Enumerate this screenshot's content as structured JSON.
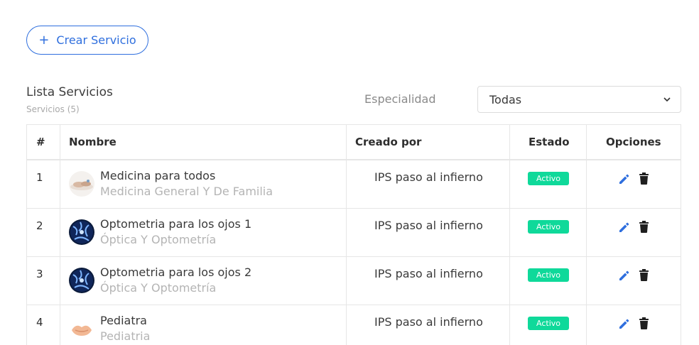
{
  "toolbar": {
    "create_label": "Crear Servicio",
    "create_icon": "plus-icon"
  },
  "list": {
    "title": "Lista Servicios",
    "subtitle": "Servicios (5)"
  },
  "filter": {
    "label": "Especialidad",
    "selected": "Todas"
  },
  "table": {
    "headers": [
      "#",
      "Nombre",
      "Creado por",
      "Estado",
      "Opciones"
    ],
    "rows": [
      {
        "index": "1",
        "name": "Medicina para todos",
        "specialty": "Medicina General Y De Familia",
        "creator": "IPS paso al infierno",
        "status": "Activo",
        "thumb": "medicine"
      },
      {
        "index": "2",
        "name": "Optometria para los ojos 1",
        "specialty": "Óptica Y Optometría",
        "creator": "IPS paso al infierno",
        "status": "Activo",
        "thumb": "optometry"
      },
      {
        "index": "3",
        "name": "Optometria para los ojos 2",
        "specialty": "Óptica Y Optometría",
        "creator": "IPS paso al infierno",
        "status": "Activo",
        "thumb": "optometry"
      },
      {
        "index": "4",
        "name": "Pediatra",
        "specialty": "Pediatria",
        "creator": "IPS paso al infierno",
        "status": "Activo",
        "thumb": "pediatrics"
      }
    ]
  },
  "colors": {
    "accent": "#2f6fde",
    "status_active": "#0fd99a",
    "edit_icon": "#2f6fde",
    "delete_icon": "#1f1f1f"
  }
}
